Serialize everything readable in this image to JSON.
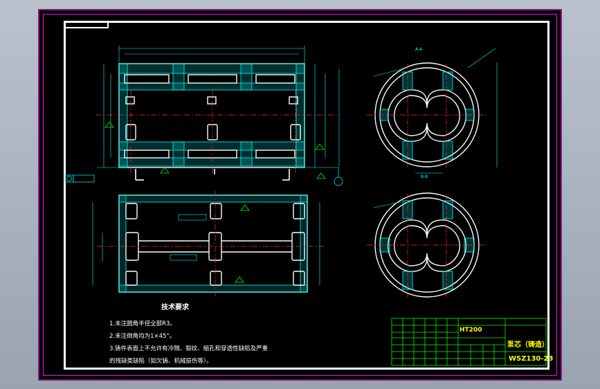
{
  "drawing": {
    "technical_requirements_title": "技术要求",
    "notes": [
      "1.未注圆角半径全部R3。",
      "2.未注倒角均为1×45°。",
      "3.铸件表面上不允许有冷隔、裂纹、缩孔和穿透性缺陷及严重",
      "的残缺类缺陷（如欠铸、机械损伤等）。"
    ],
    "title_block": {
      "material": "HT200",
      "part_name": "泵芯（铸造）",
      "drawing_code": "WSZ130-23"
    },
    "section_labels": {
      "top_right": "A-A",
      "middle_right": "B-B"
    }
  },
  "colors": {
    "background": "#000000",
    "outline": "#ffffff",
    "hatch": "#00ffff",
    "centerline": "#ff3030",
    "dimension": "#00ffff",
    "title_text": "#ffff00",
    "title_grid": "#00ff00",
    "frame_magenta": "#ff00ff"
  }
}
